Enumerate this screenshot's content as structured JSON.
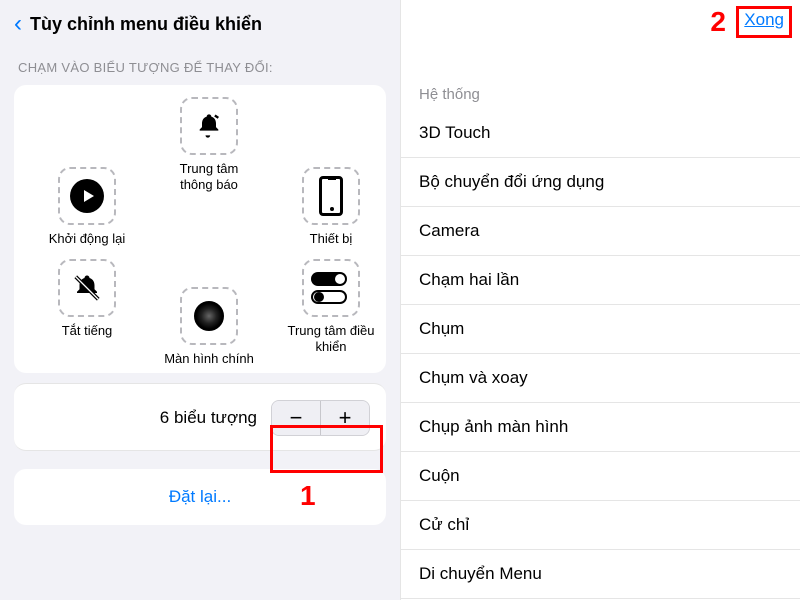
{
  "left": {
    "title": "Tùy chỉnh menu điều khiển",
    "section_header": "CHẠM VÀO BIỂU TƯỢNG ĐỂ THAY ĐỔI:",
    "slots": {
      "top": {
        "label": "Trung tâm thông báo",
        "icon": "bell"
      },
      "left": {
        "label": "Khởi động lại",
        "icon": "restart"
      },
      "right": {
        "label": "Thiết bị",
        "icon": "device"
      },
      "bl": {
        "label": "Tắt tiếng",
        "icon": "mute"
      },
      "bc": {
        "label": "Màn hình chính",
        "icon": "home"
      },
      "br": {
        "label": "Trung tâm điều khiển",
        "icon": "control-center"
      }
    },
    "stepper_label": "6 biểu tượng",
    "reset": "Đặt lại..."
  },
  "right": {
    "done": "Xong",
    "header": "Hệ thống",
    "items": [
      "3D Touch",
      "Bộ chuyển đổi ứng dụng",
      "Camera",
      "Chạm hai lần",
      "Chụm",
      "Chụm và xoay",
      "Chụp ảnh màn hình",
      "Cuộn",
      "Cử chỉ",
      "Di chuyển Menu"
    ]
  },
  "callouts": {
    "one": "1",
    "two": "2"
  }
}
